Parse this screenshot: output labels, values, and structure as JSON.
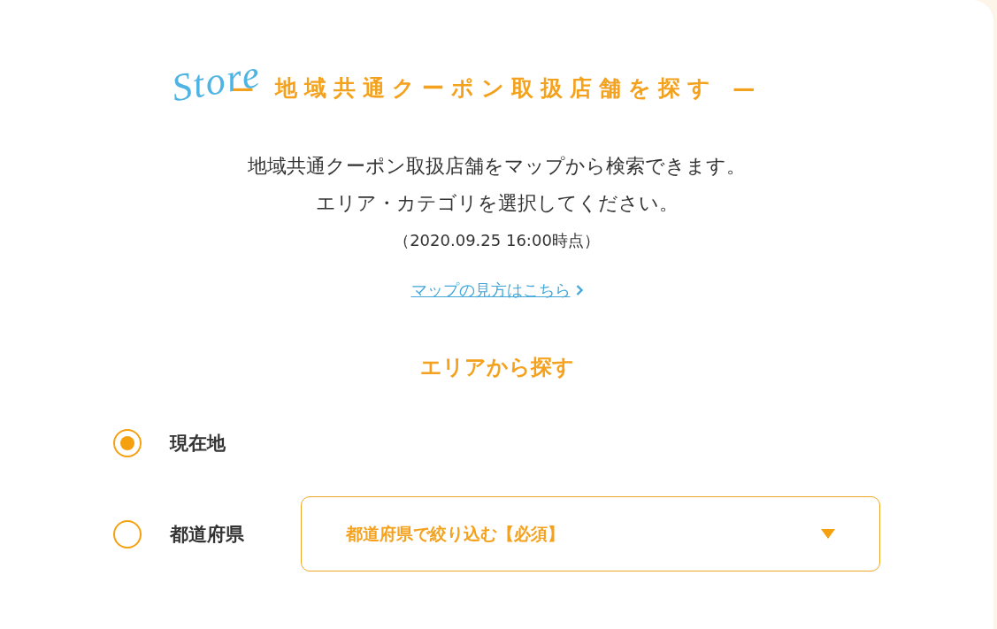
{
  "heading": {
    "script_word": "Store",
    "title": "— 地域共通クーポン取扱店舗を探す —"
  },
  "intro": {
    "lines": [
      "地域共通クーポン取扱店舗をマップから検索できます。",
      "エリア・カテゴリを選択してください。"
    ],
    "as_of": "（2020.09.25 16:00時点）",
    "help_link": "マップの見方はこちら"
  },
  "area_search": {
    "title": "エリアから探す",
    "options": [
      {
        "label": "現在地",
        "selected": true
      },
      {
        "label": "都道府県",
        "selected": false,
        "dropdown": {
          "placeholder": "都道府県で絞り込む【必須】"
        }
      }
    ]
  }
}
